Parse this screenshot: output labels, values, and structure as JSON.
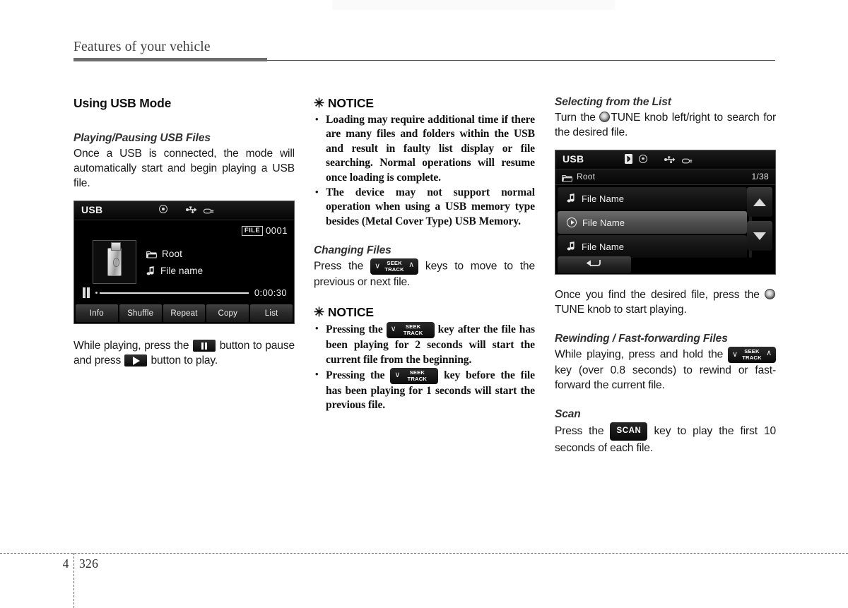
{
  "header": {
    "title": "Features of your vehicle"
  },
  "footer": {
    "chapter": "4",
    "page": "326"
  },
  "left_column": {
    "section_title": "Using USB Mode",
    "sub_title": "Playing/Pausing USB Files",
    "intro": "Once a USB is connected, the mode will automatically start and begin playing a USB file.",
    "player_screen": {
      "source_label": "USB",
      "icons": [
        "disc-icon",
        "usb-icon",
        "usb-plug-icon"
      ],
      "file_badge_label": "FILE",
      "file_badge_number": "0001",
      "folder_name": "Root",
      "file_name": "File name",
      "time": "0:00:30",
      "transport_state": "pause-icon",
      "buttons": [
        "Info",
        "Shuffle",
        "Repeat",
        "Copy",
        "List"
      ]
    },
    "after_text_1": "While playing, press the",
    "after_text_2": "button to pause and press",
    "after_text_3": "button to play."
  },
  "middle_column": {
    "notice_1": {
      "star": "✳",
      "heading": "NOTICE",
      "items": [
        "Loading may require additional time if there are many files and folders within the USB and result in faulty list display or file searching. Normal operations will resume once loading is complete.",
        "The device may not support normal operation when using a USB memory type besides (Metal Cover Type) USB Memory."
      ]
    },
    "changing_files": {
      "sub_title": "Changing Files",
      "text_before": "Press the",
      "text_after": "keys to move to the previous or next file.",
      "key": {
        "top": "SEEK",
        "bottom": "TRACK"
      }
    },
    "notice_2": {
      "star": "✳",
      "heading": "NOTICE",
      "item_1_before": "Pressing the",
      "item_1_after": "key after the file has been playing for 2 seconds will start the current file from the beginning.",
      "item_2_before": "Pressing the",
      "item_2_after": "key before the file has been playing for 1 seconds will start the previous file.",
      "key": {
        "top": "SEEK",
        "bottom": "TRACK"
      }
    }
  },
  "right_column": {
    "selecting": {
      "sub_title": "Selecting from the List",
      "text_before": "Turn the",
      "knob_label": "TUNE",
      "text_after": "knob left/right to search for the desired file."
    },
    "list_screen": {
      "source_label": "USB",
      "icons": [
        "bluetooth-icon",
        "disc-icon",
        "usb-icon",
        "usb-plug-icon"
      ],
      "path": "Root",
      "counter": "1/38",
      "rows": [
        {
          "icon": "music-note-icon",
          "label": "File Name",
          "selected": false
        },
        {
          "icon": "play-circle-icon",
          "label": "File Name",
          "selected": true
        },
        {
          "icon": "music-note-icon",
          "label": "File Name",
          "selected": false
        }
      ],
      "nav_up": "up-arrow-icon",
      "nav_down": "down-arrow-icon",
      "back": "back-arrow-icon"
    },
    "after_list": {
      "text_before": "Once you find the desired file, press the",
      "knob_label": "TUNE",
      "text_after": "knob to start playing."
    },
    "rewinding": {
      "sub_title": "Rewinding / Fast-forwarding Files",
      "text_before": "While playing, press and hold the",
      "text_after": "key (over 0.8 seconds) to rewind or fast-forward the current file.",
      "key": {
        "top": "SEEK",
        "bottom": "TRACK"
      }
    },
    "scan": {
      "sub_title": "Scan",
      "text_before": "Press the",
      "key_label": "SCAN",
      "text_after": "key to play the first 10 seconds of each file."
    }
  }
}
